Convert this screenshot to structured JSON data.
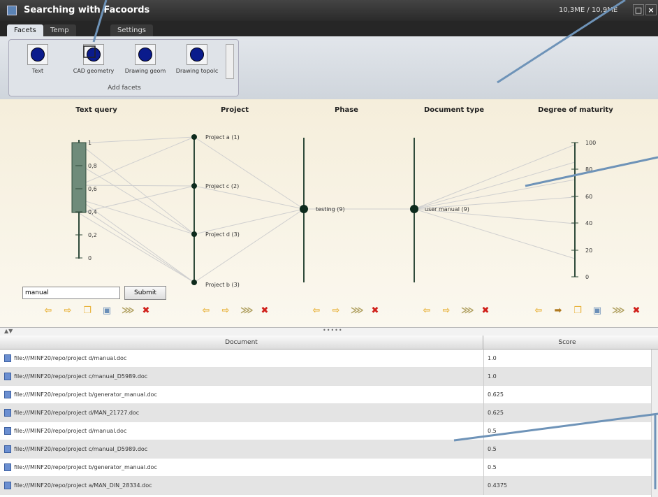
{
  "window": {
    "title": "Searching with Facoords",
    "memory": "10,3ME / 10,9ME"
  },
  "tabs": [
    "Facets",
    "Temp",
    "Settings"
  ],
  "ribbon": {
    "facets": [
      {
        "label": "Text"
      },
      {
        "label": "CAD geometry"
      },
      {
        "label": "Drawing geom"
      },
      {
        "label": "Drawing topolc"
      }
    ],
    "group_label": "Add facets"
  },
  "headers": {
    "text_query": "Text query",
    "project": "Project",
    "phase": "Phase",
    "doctype": "Document type",
    "maturity": "Degree of maturity"
  },
  "text_axis_ticks": [
    "1",
    "0,8",
    "0,6",
    "0,4",
    "0,2",
    "0"
  ],
  "maturity_ticks": [
    "100",
    "80",
    "60",
    "40",
    "20",
    "0"
  ],
  "project_nodes": [
    "Project a (1)",
    "Project c (2)",
    "Project d (3)",
    "Project b (3)"
  ],
  "phase_nodes": [
    "testing (9)"
  ],
  "doctype_nodes": [
    "user manual (9)"
  ],
  "query": {
    "value": "manual",
    "submit_label": "Submit"
  },
  "table": {
    "headers": [
      "Document",
      "Score"
    ],
    "rows": [
      {
        "doc": "file:///MINF20/repo/project d/manual.doc",
        "score": "1.0"
      },
      {
        "doc": "file:///MINF20/repo/project c/manual_D5989.doc",
        "score": "1.0"
      },
      {
        "doc": "file:///MINF20/repo/project b/generator_manual.doc",
        "score": "0.625"
      },
      {
        "doc": "file:///MINF20/repo/project d/MAN_21727.doc",
        "score": "0.625"
      },
      {
        "doc": "file:///MINF20/repo/project d/manual.doc",
        "score": "0.5"
      },
      {
        "doc": "file:///MINF20/repo/project c/manual_D5989.doc",
        "score": "0.5"
      },
      {
        "doc": "file:///MINF20/repo/project b/generator_manual.doc",
        "score": "0.5"
      },
      {
        "doc": "file:///MINF20/repo/project a/MAN_DIN_28334.doc",
        "score": "0.4375"
      }
    ]
  },
  "colors": {
    "axis": "#2f4a3a",
    "node": "#0d2a1c",
    "line": "#cfcfcf",
    "add_icon": "#e8b23a",
    "remove_icon": "#d0201a",
    "callout": "#6e93b8"
  }
}
